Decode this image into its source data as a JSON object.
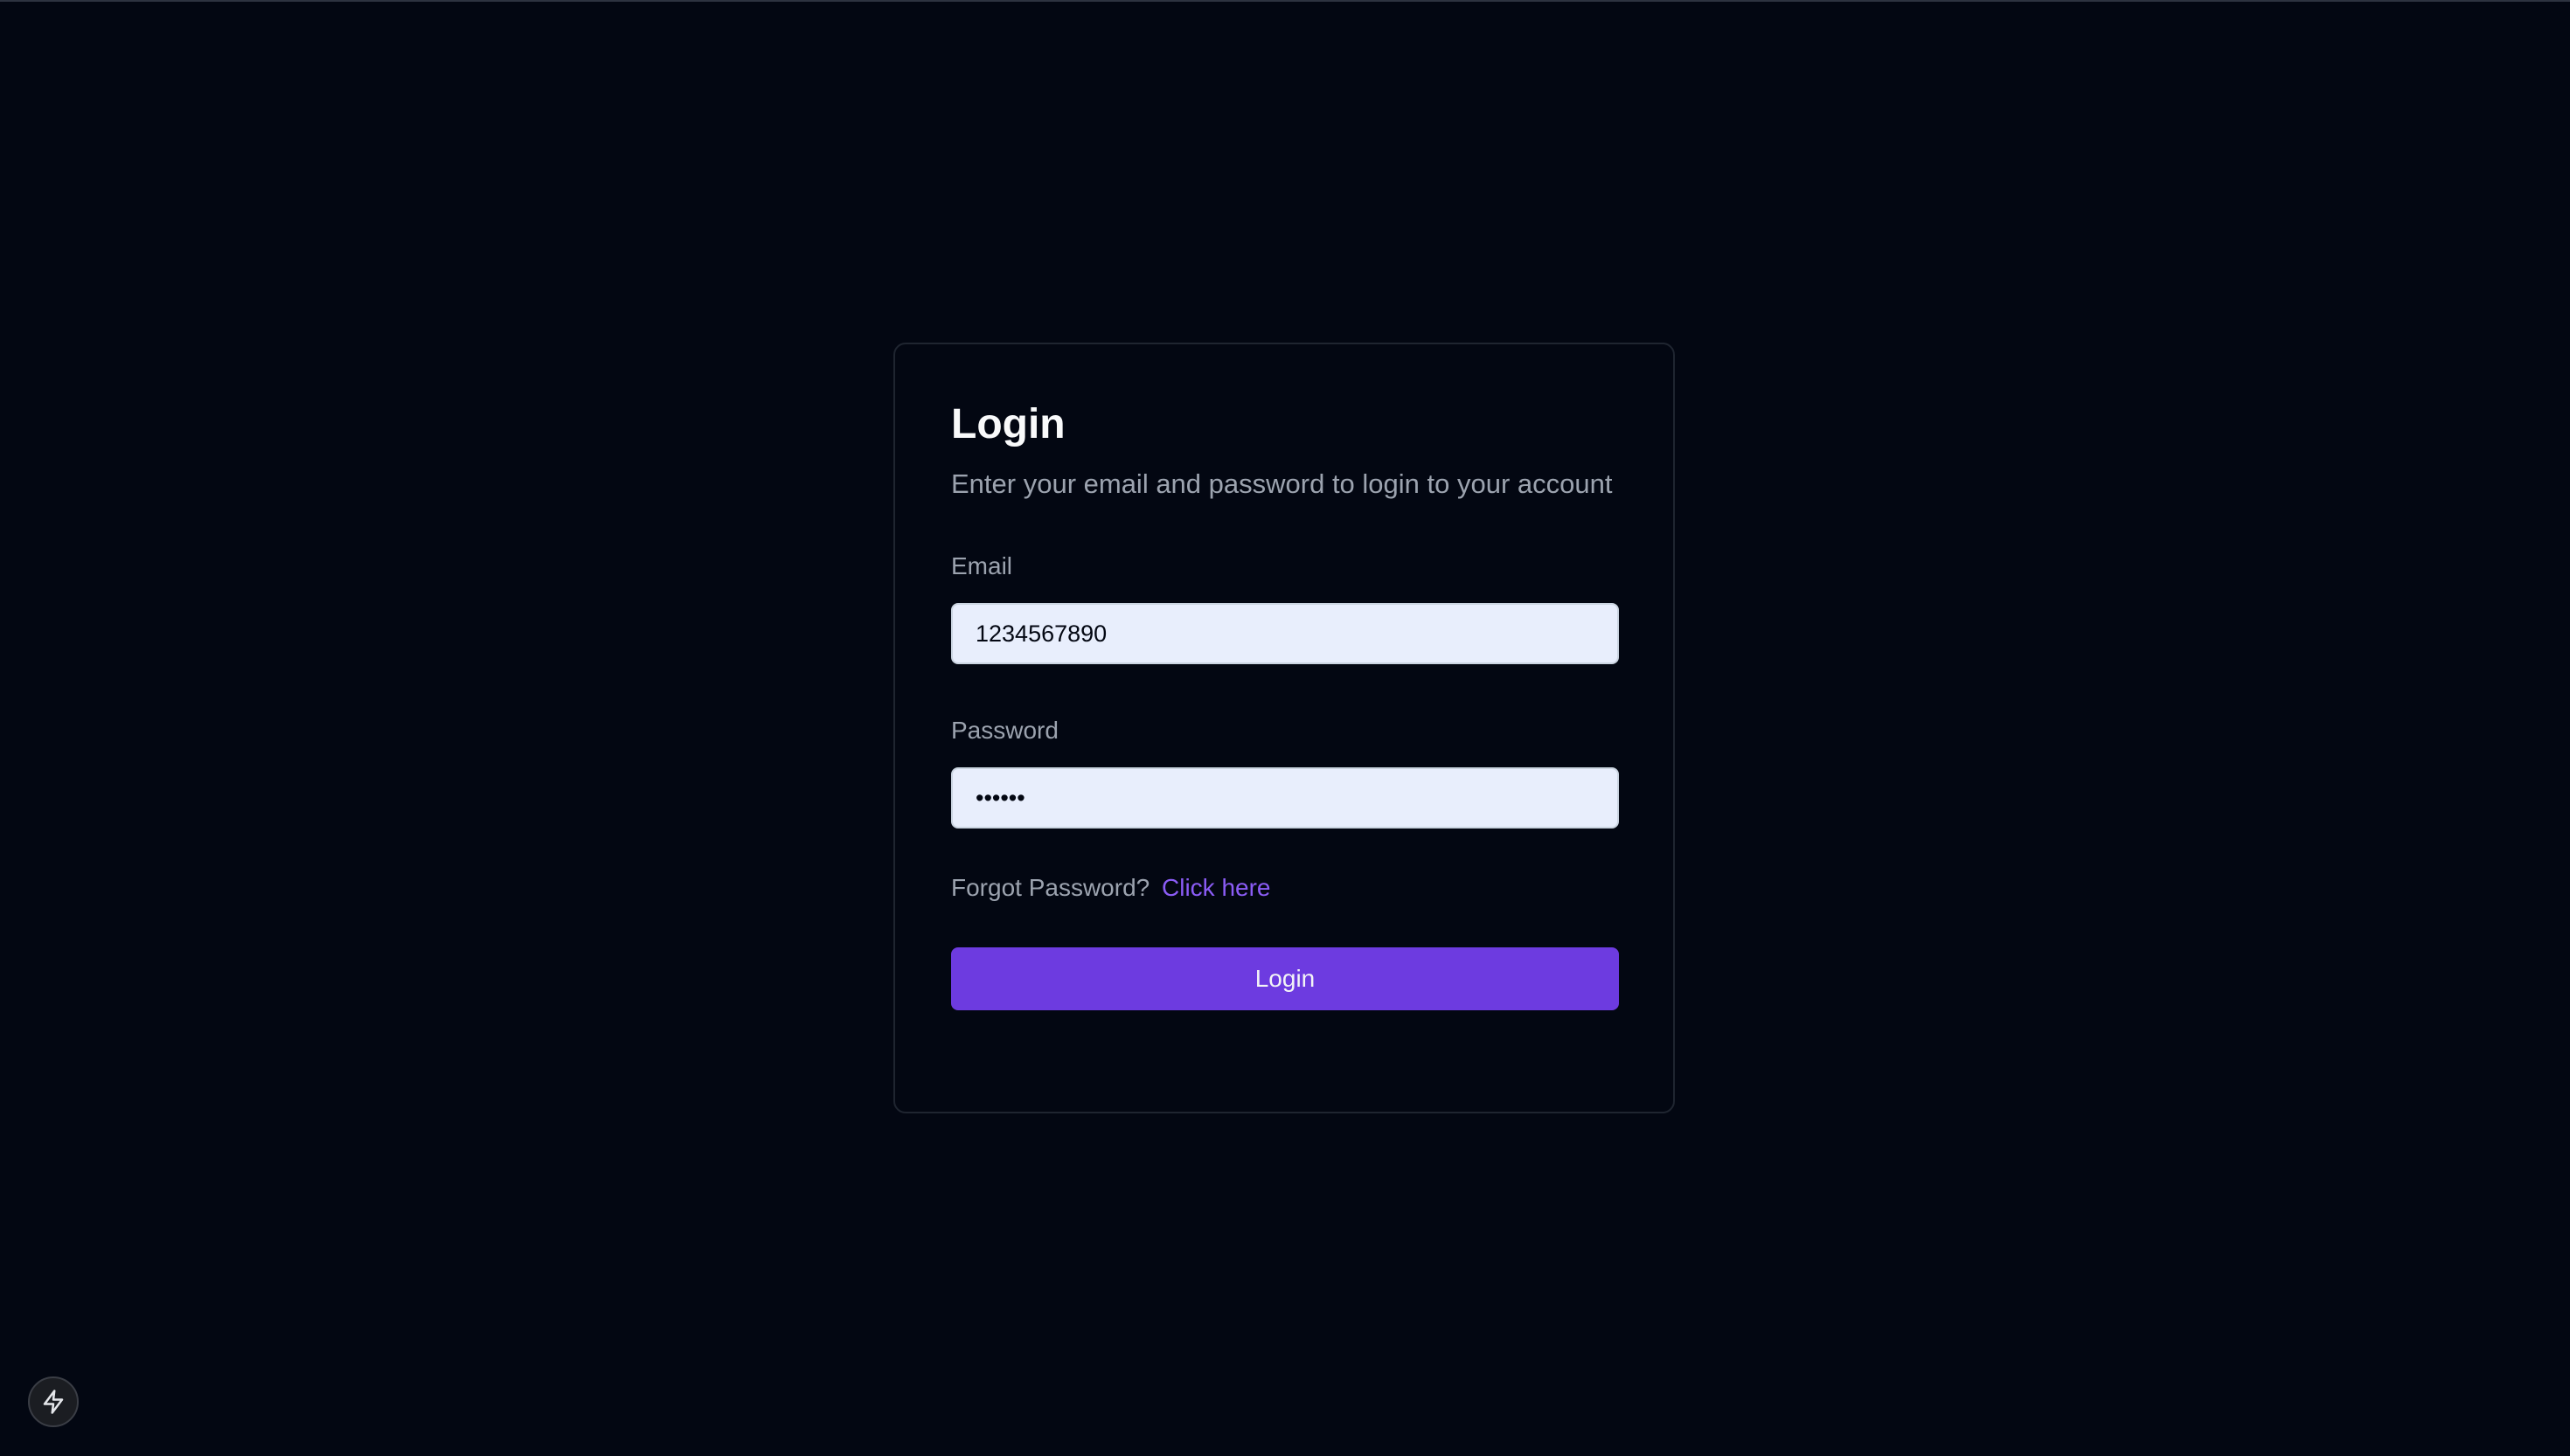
{
  "login": {
    "title": "Login",
    "subtitle": "Enter your email and password to login to your account",
    "email_label": "Email",
    "email_value": "1234567890",
    "password_label": "Password",
    "password_value": "123456",
    "forgot_text": "Forgot Password?",
    "forgot_link": "Click here",
    "submit_label": "Login"
  },
  "corner_badge": {
    "icon": "lightning-bolt-icon"
  },
  "colors": {
    "background": "#030712",
    "accent": "#6d3be0",
    "link": "#8b5cf6",
    "input_bg": "#e8eefc"
  }
}
